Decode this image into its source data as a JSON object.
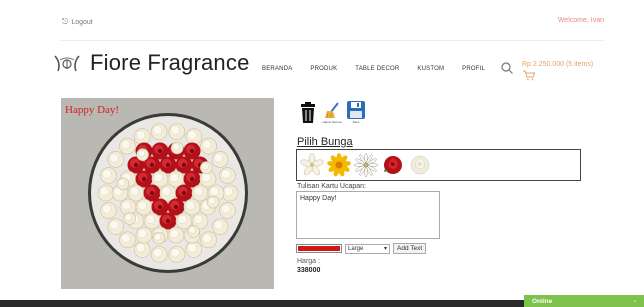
{
  "topbar": {
    "logout_label": "Logout",
    "welcome_text": "Welcome, Ivan"
  },
  "header": {
    "brand": "Fiore Fragrance",
    "nav": [
      "BERANDA",
      "PRODUK",
      "TABLE DECOR",
      "KUSTOM",
      "PROFIL"
    ],
    "cart_total": "Rp 2.250.000 (5 items)"
  },
  "canvas": {
    "card_message": "Happy Day!",
    "background_color": "#b9b8b3",
    "plate_color": "#e9e8e4",
    "rose_color": "#b3101a",
    "white_rose_color": "#f3ecd6"
  },
  "tools": {
    "delete_icon": "trash-icon",
    "clear_icon": "broom-icon",
    "clear_label": "Hapus Semua",
    "save_icon": "floppy-disk-icon",
    "save_label": "Save"
  },
  "flowers": {
    "title": "Pilih Bunga",
    "options": [
      "white-lily",
      "yellow-sunflower",
      "white-daisy",
      "red-rose",
      "white-rose"
    ]
  },
  "card": {
    "label": "Tulisan Kartu Ucapan:",
    "value": "Happy Day!"
  },
  "text_controls": {
    "color": "#d01818",
    "size_selected": "Large",
    "add_button": "Add Text"
  },
  "price": {
    "label": "Harga :",
    "value": "338000"
  },
  "chat": {
    "status": "Online",
    "toggle": "-"
  }
}
